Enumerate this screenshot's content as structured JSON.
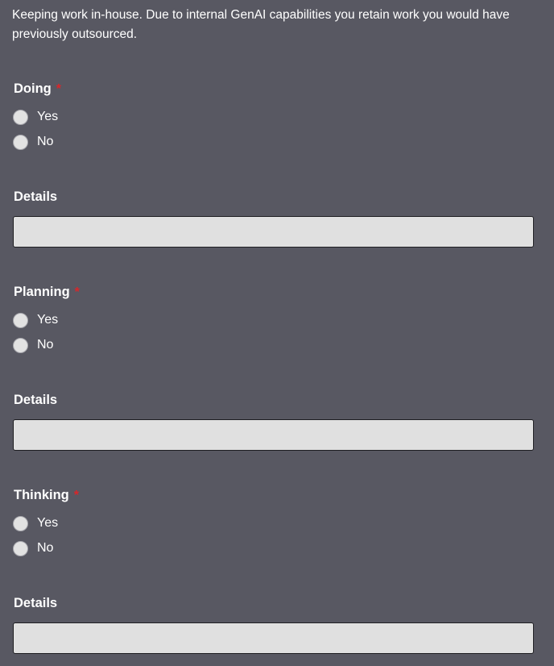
{
  "intro_text": "Keeping work in-house. Due to internal GenAI capabilities you retain work you would have previously outsourced.",
  "required_marker": "*",
  "questions": [
    {
      "label": "Doing",
      "options": [
        {
          "label": "Yes",
          "selected": false
        },
        {
          "label": "No",
          "selected": false
        }
      ],
      "details_label": "Details",
      "details_value": ""
    },
    {
      "label": "Planning",
      "options": [
        {
          "label": "Yes",
          "selected": false
        },
        {
          "label": "No",
          "selected": false
        }
      ],
      "details_label": "Details",
      "details_value": ""
    },
    {
      "label": "Thinking",
      "options": [
        {
          "label": "Yes",
          "selected": false
        },
        {
          "label": "No",
          "selected": false
        }
      ],
      "details_label": "Details",
      "details_value": ""
    }
  ],
  "colors": {
    "background": "#585862",
    "text": "#ffffff",
    "required": "#d9262a",
    "input_fill": "#e0e0e0"
  }
}
